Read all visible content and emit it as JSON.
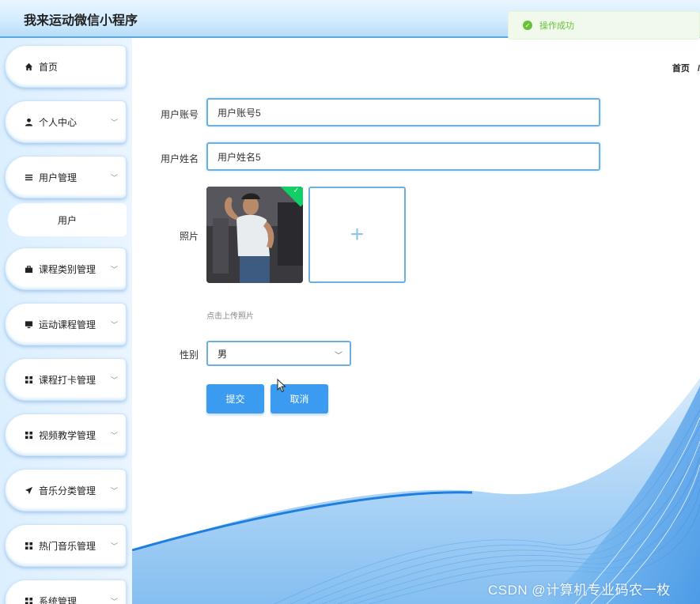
{
  "app": {
    "title": "我来运动微信小程序"
  },
  "toast": {
    "message": "操作成功"
  },
  "sidebar": {
    "items": [
      {
        "label": "首页",
        "icon": "home-icon"
      },
      {
        "label": "个人中心",
        "icon": "user-icon"
      },
      {
        "label": "用户管理",
        "icon": "list-icon"
      },
      {
        "label": "用户",
        "icon": ""
      },
      {
        "label": "课程类别管理",
        "icon": "briefcase-icon"
      },
      {
        "label": "运动课程管理",
        "icon": "monitor-icon"
      },
      {
        "label": "课程打卡管理",
        "icon": "grid-icon"
      },
      {
        "label": "视频教学管理",
        "icon": "grid-icon"
      },
      {
        "label": "音乐分类管理",
        "icon": "send-icon"
      },
      {
        "label": "热门音乐管理",
        "icon": "grid-icon"
      },
      {
        "label": "系统管理",
        "icon": "grid-icon"
      }
    ]
  },
  "breadcrumb": {
    "home": "首页",
    "separator": "/"
  },
  "form": {
    "account": {
      "label": "用户账号",
      "value": "用户账号5"
    },
    "name": {
      "label": "用户姓名",
      "value": "用户姓名5"
    },
    "photo": {
      "label": "照片",
      "upload_tip": "点击上传照片",
      "upload_plus": "+"
    },
    "gender": {
      "label": "性别",
      "value": "男"
    },
    "submit_label": "提交",
    "cancel_label": "取消"
  },
  "watermark": "CSDN @计算机专业码农一枚",
  "colors": {
    "accent": "#3a9bf0",
    "success": "#67c23a",
    "border": "#6cb0e0"
  }
}
